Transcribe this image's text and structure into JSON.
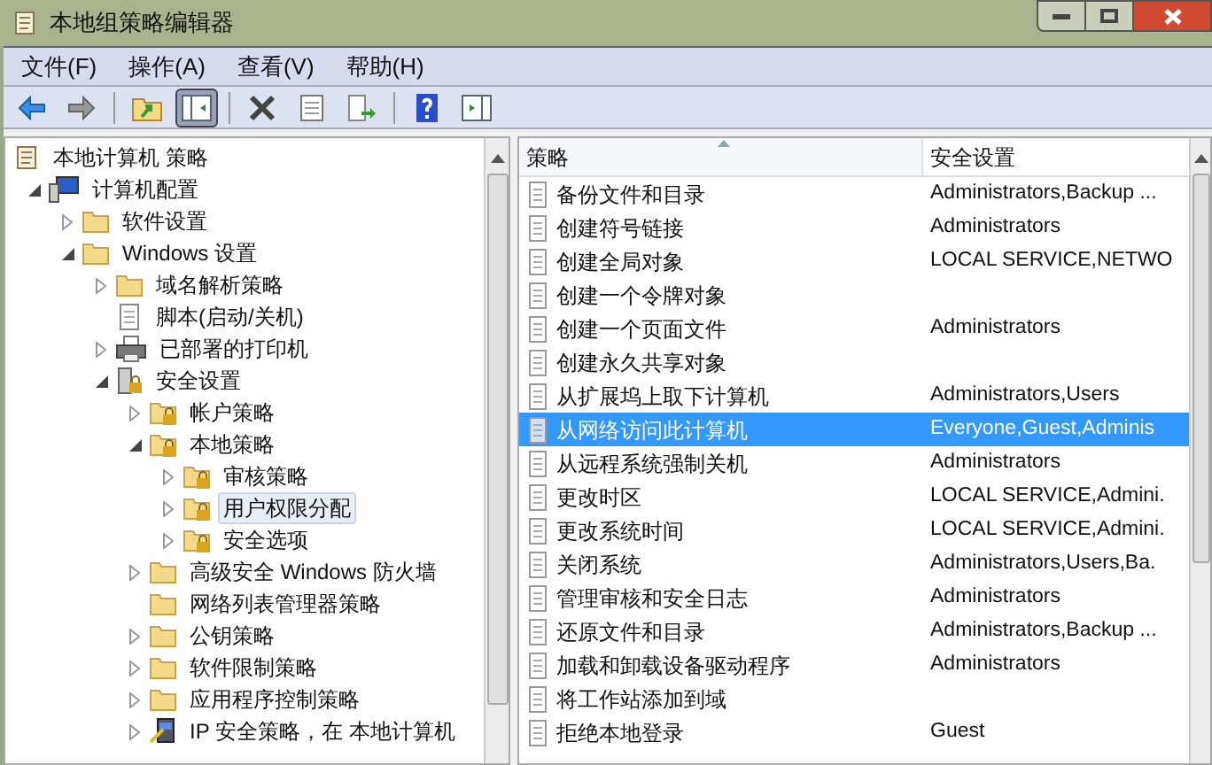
{
  "window": {
    "title": "本地组策略编辑器"
  },
  "menu": [
    "文件(F)",
    "操作(A)",
    "查看(V)",
    "帮助(H)"
  ],
  "toolbar": [
    [
      {
        "kind": "back",
        "pressed": false
      },
      {
        "kind": "forward",
        "pressed": false
      }
    ],
    [
      {
        "kind": "up",
        "pressed": false
      },
      {
        "kind": "tree",
        "pressed": true
      }
    ],
    [
      {
        "kind": "delete",
        "pressed": false
      },
      {
        "kind": "properties",
        "pressed": false
      },
      {
        "kind": "export",
        "pressed": false
      }
    ],
    [
      {
        "kind": "help",
        "pressed": false
      },
      {
        "kind": "pane",
        "pressed": false
      }
    ]
  ],
  "tree": [
    {
      "label": "本地计算机 策略",
      "kind": "policy",
      "selected": false,
      "children": [
        {
          "label": "计算机配置",
          "kind": "computer",
          "expanded": true,
          "selected": false,
          "children": [
            {
              "label": "软件设置",
              "kind": "folder",
              "expanded": false,
              "selected": false
            },
            {
              "label": "Windows 设置",
              "kind": "folder",
              "expanded": true,
              "selected": false,
              "children": [
                {
                  "label": "域名解析策略",
                  "kind": "folder",
                  "expanded": false,
                  "selected": false
                },
                {
                  "label": "脚本(启动/关机)",
                  "kind": "script",
                  "selected": false
                },
                {
                  "label": "已部署的打印机",
                  "kind": "printer",
                  "expanded": false,
                  "selected": false
                },
                {
                  "label": "安全设置",
                  "kind": "security",
                  "expanded": true,
                  "selected": false,
                  "children": [
                    {
                      "label": "帐户策略",
                      "kind": "locked",
                      "expanded": false,
                      "selected": false
                    },
                    {
                      "label": "本地策略",
                      "kind": "locked",
                      "expanded": true,
                      "selected": false,
                      "children": [
                        {
                          "label": "审核策略",
                          "kind": "locked",
                          "expanded": false,
                          "selected": false
                        },
                        {
                          "label": "用户权限分配",
                          "kind": "locked",
                          "expanded": false,
                          "selected": true
                        },
                        {
                          "label": "安全选项",
                          "kind": "locked",
                          "expanded": false,
                          "selected": false
                        }
                      ]
                    },
                    {
                      "label": "高级安全 Windows 防火墙",
                      "kind": "folder",
                      "expanded": false,
                      "selected": false
                    },
                    {
                      "label": "网络列表管理器策略",
                      "kind": "folder",
                      "selected": false
                    },
                    {
                      "label": "公钥策略",
                      "kind": "folder",
                      "expanded": false,
                      "selected": false
                    },
                    {
                      "label": "软件限制策略",
                      "kind": "folder",
                      "expanded": false,
                      "selected": false
                    },
                    {
                      "label": "应用程序控制策略",
                      "kind": "folder",
                      "expanded": false,
                      "selected": false
                    },
                    {
                      "label": "IP 安全策略，在 本地计算机",
                      "kind": "ip",
                      "expanded": false,
                      "selected": false
                    }
                  ]
                }
              ]
            }
          ]
        }
      ]
    }
  ],
  "table": {
    "columns": [
      "策略",
      "安全设置"
    ],
    "rows": [
      {
        "policy": "备份文件和目录",
        "setting": "Administrators,Backup ...",
        "selected": false
      },
      {
        "policy": "创建符号链接",
        "setting": "Administrators",
        "selected": false
      },
      {
        "policy": "创建全局对象",
        "setting": "LOCAL SERVICE,NETWO",
        "selected": false
      },
      {
        "policy": "创建一个令牌对象",
        "selected": false
      },
      {
        "policy": "创建一个页面文件",
        "setting": "Administrators",
        "selected": false
      },
      {
        "policy": "创建永久共享对象",
        "selected": false
      },
      {
        "policy": "从扩展坞上取下计算机",
        "setting": "Administrators,Users",
        "selected": false
      },
      {
        "policy": "从网络访问此计算机",
        "setting": "Everyone,Guest,Adminis",
        "selected": true
      },
      {
        "policy": "从远程系统强制关机",
        "setting": "Administrators",
        "selected": false
      },
      {
        "policy": "更改时区",
        "setting": "LOCAL SERVICE,Admini.",
        "selected": false
      },
      {
        "policy": "更改系统时间",
        "setting": "LOCAL SERVICE,Admini.",
        "selected": false
      },
      {
        "policy": "关闭系统",
        "setting": "Administrators,Users,Ba.",
        "selected": false
      },
      {
        "policy": "管理审核和安全日志",
        "setting": "Administrators",
        "selected": false
      },
      {
        "policy": "还原文件和目录",
        "setting": "Administrators,Backup ...",
        "selected": false
      },
      {
        "policy": "加载和卸载设备驱动程序",
        "setting": "Administrators",
        "selected": false
      },
      {
        "policy": "将工作站添加到域",
        "selected": false
      },
      {
        "policy": "拒绝本地登录",
        "setting": "Guest",
        "selected": false
      }
    ]
  }
}
